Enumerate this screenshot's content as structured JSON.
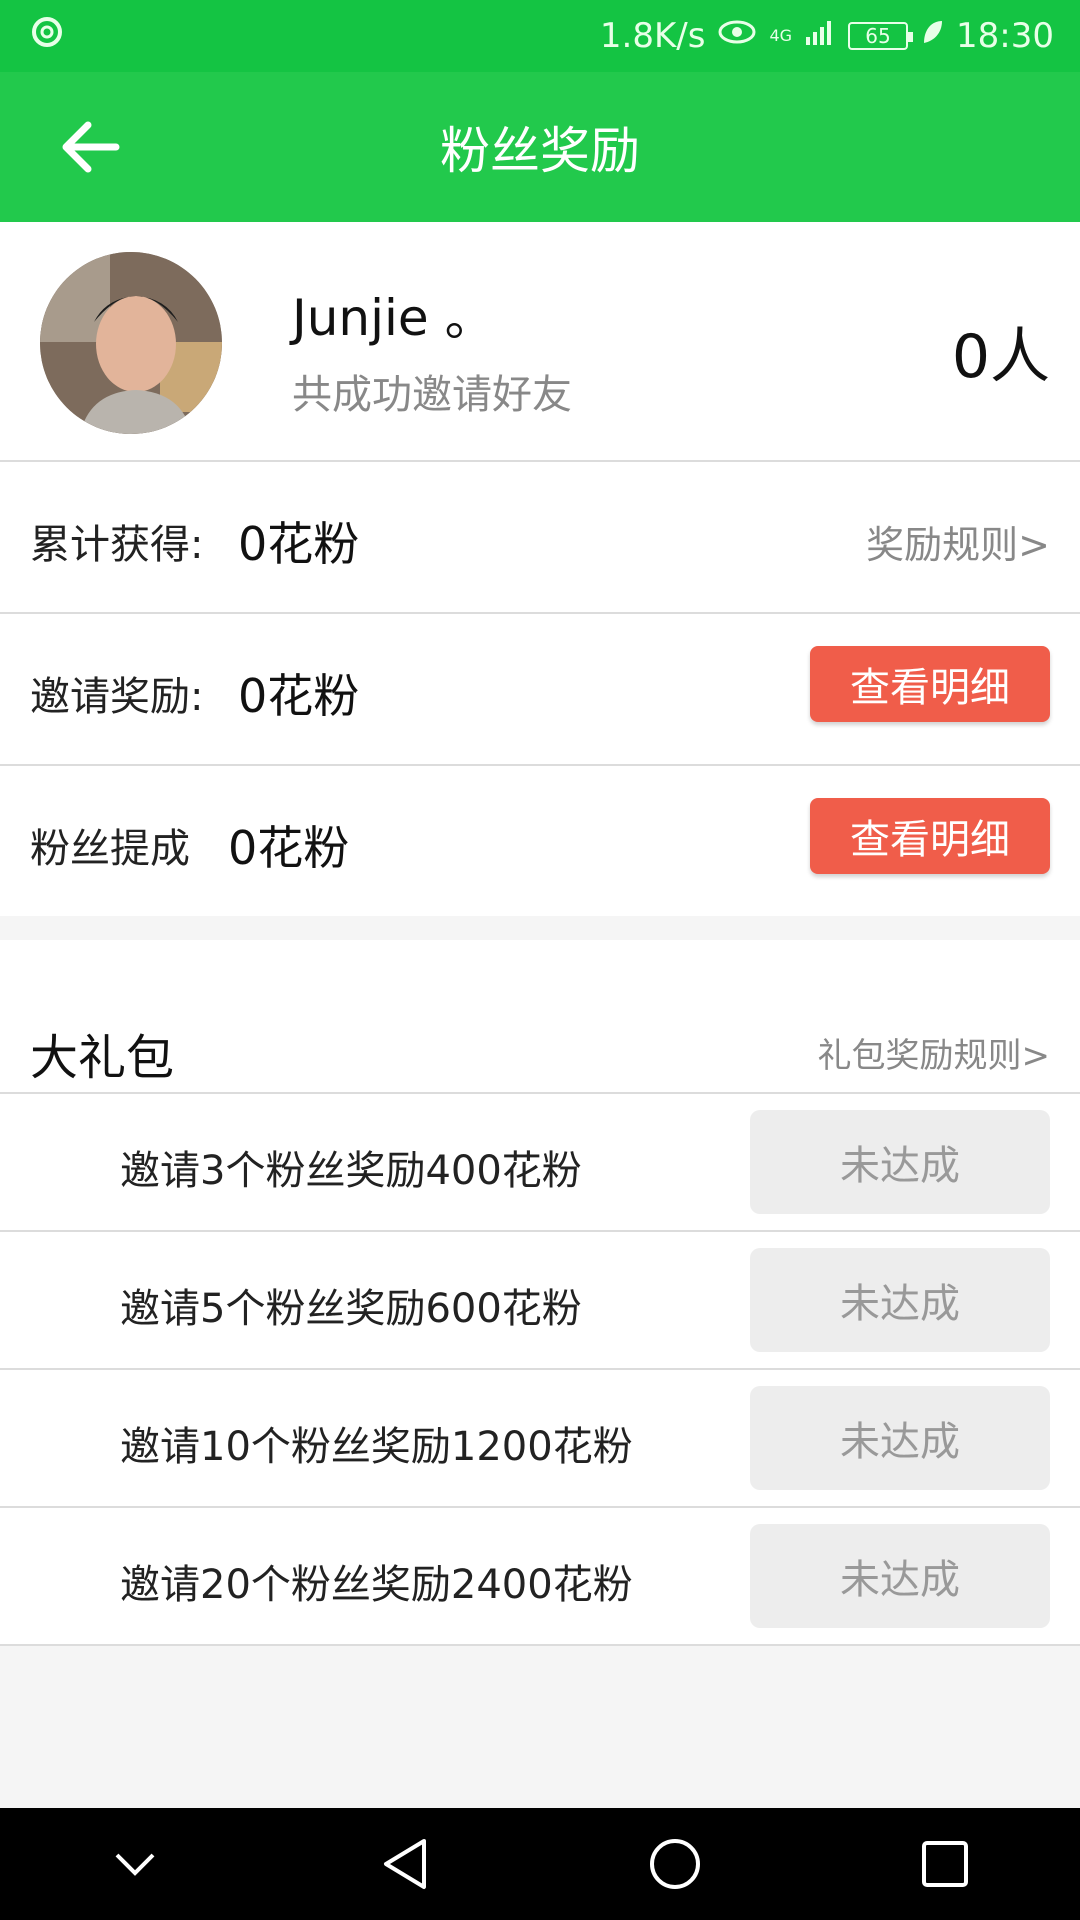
{
  "status_bar": {
    "network_speed": "1.8K/s",
    "network_type": "4G",
    "battery": "65",
    "time": "18:30",
    "left_icon": "swirl-icon",
    "icons": [
      "eye-icon",
      "signal-icon",
      "leaf-icon"
    ]
  },
  "app_bar": {
    "title": "粉丝奖励",
    "back_icon": "back-arrow-icon"
  },
  "profile": {
    "name": "Junjie 。",
    "subtitle": "共成功邀请好友",
    "invite_count": "0人"
  },
  "rewards": {
    "total": {
      "label": "累计获得:",
      "value": "0花粉",
      "link": "奖励规则>"
    },
    "invite": {
      "label": "邀请奖励:",
      "value": "0花粉",
      "button": "查看明细"
    },
    "commission": {
      "label": "粉丝提成",
      "value": "0花粉",
      "button": "查看明细"
    }
  },
  "gift": {
    "title": "大礼包",
    "rule_link": "礼包奖励规则>",
    "items": [
      {
        "text": "邀请3个粉丝奖励400花粉",
        "status": "未达成"
      },
      {
        "text": "邀请5个粉丝奖励600花粉",
        "status": "未达成"
      },
      {
        "text": "邀请10个粉丝奖励1200花粉",
        "status": "未达成"
      },
      {
        "text": "邀请20个粉丝奖励2400花粉",
        "status": "未达成"
      }
    ]
  },
  "colors": {
    "status_bar": "#14c443",
    "app_bar": "#22c94c",
    "detail_button": "#f05d4a",
    "status_button": "#ededed"
  }
}
